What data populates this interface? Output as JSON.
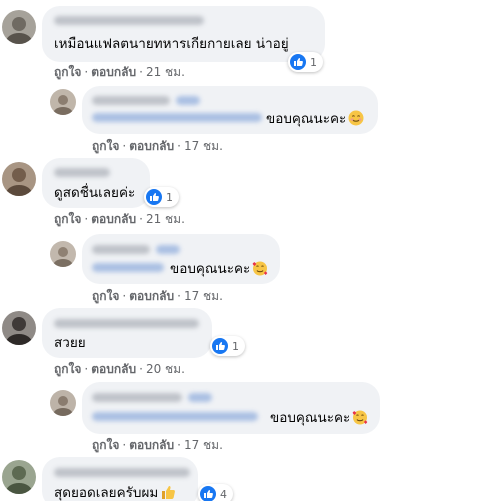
{
  "actions": {
    "like": "ถูกใจ",
    "reply": "ตอบกลับ",
    "separator": "·"
  },
  "comments": [
    {
      "text": "เหมือนแฟลตนายทหารเกียกายเลย น่าอยู่",
      "time": "21 ชม.",
      "reaction_count": "1"
    },
    {
      "text": "ขอบคุณนะคะ",
      "emoji": "smiling-face-icon",
      "time": "17 ชม."
    },
    {
      "text": "ดูสดชื่นเลยค่ะ",
      "time": "21 ชม.",
      "reaction_count": "1"
    },
    {
      "text": "ขอบคุณนะคะ",
      "emoji": "smiling-face-with-hearts-icon",
      "time": "17 ชม."
    },
    {
      "text": "สวยย",
      "time": "20 ชม.",
      "reaction_count": "1"
    },
    {
      "text": "ขอบคุณนะคะ",
      "emoji": "smiling-face-with-hearts-icon",
      "time": "17 ชม."
    },
    {
      "text": "สุดยอดเลยครับผม",
      "emoji": "thumbs-up-icon",
      "reaction_count": "4"
    }
  ],
  "colors": {
    "bubble": "#f0f2f5",
    "meta": "#65676b",
    "like": "#1877f2",
    "text": "#050505"
  }
}
